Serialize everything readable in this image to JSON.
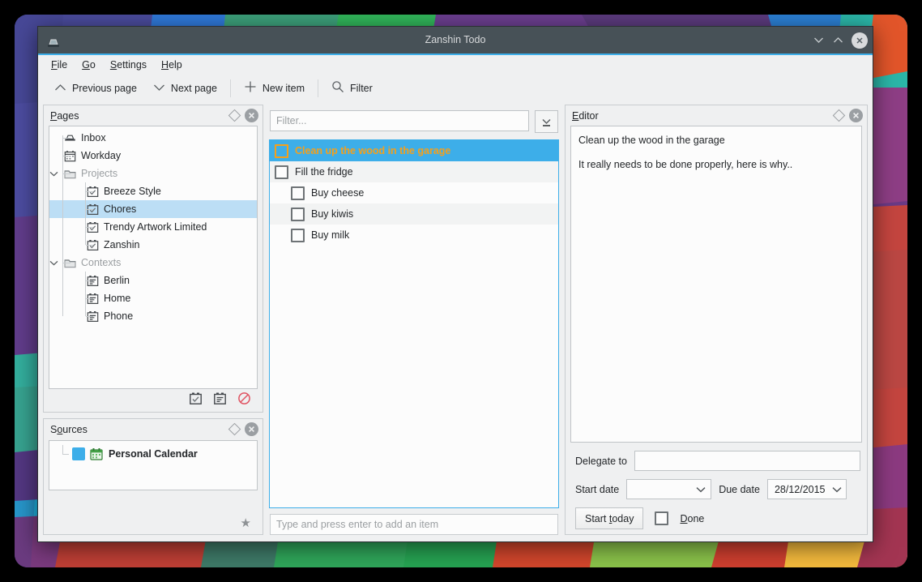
{
  "window": {
    "title": "Zanshin Todo",
    "app_icon": "inbox-icon",
    "minimize_label": "v",
    "maximize_label": "^",
    "close_label": "✕"
  },
  "menubar": {
    "items": [
      {
        "label": "File",
        "accel": "F"
      },
      {
        "label": "Go",
        "accel": "G"
      },
      {
        "label": "Settings",
        "accel": "S"
      },
      {
        "label": "Help",
        "accel": "H"
      }
    ]
  },
  "toolbar": {
    "buttons": [
      {
        "label": "Previous page",
        "icon": "chevron-up-icon"
      },
      {
        "label": "Next page",
        "icon": "chevron-down-icon"
      },
      {
        "label": "New item",
        "icon": "plus-icon"
      },
      {
        "label": "Filter",
        "icon": "search-icon"
      }
    ]
  },
  "pages_panel": {
    "title": "Pages",
    "title_accel": "P",
    "float_icon": "float-icon",
    "close_icon": "close-icon",
    "tree": [
      {
        "label": "Inbox",
        "icon": "inbox-icon",
        "depth": 0,
        "type": "item",
        "selected": false,
        "expander": ""
      },
      {
        "label": "Workday",
        "icon": "calendar-icon",
        "depth": 0,
        "type": "item",
        "selected": false,
        "expander": ""
      },
      {
        "label": "Projects",
        "icon": "folder-icon",
        "depth": 0,
        "type": "group",
        "selected": false,
        "expander": "∨"
      },
      {
        "label": "Breeze Style",
        "icon": "project-icon",
        "depth": 1,
        "type": "item",
        "selected": false,
        "expander": ""
      },
      {
        "label": "Chores",
        "icon": "project-icon",
        "depth": 1,
        "type": "item",
        "selected": true,
        "expander": ""
      },
      {
        "label": "Trendy Artwork Limited",
        "icon": "project-icon",
        "depth": 1,
        "type": "item",
        "selected": false,
        "expander": ""
      },
      {
        "label": "Zanshin",
        "icon": "project-icon",
        "depth": 1,
        "type": "item",
        "selected": false,
        "expander": ""
      },
      {
        "label": "Contexts",
        "icon": "folder-icon",
        "depth": 0,
        "type": "group",
        "selected": false,
        "expander": "∨"
      },
      {
        "label": "Berlin",
        "icon": "context-icon",
        "depth": 1,
        "type": "item",
        "selected": false,
        "expander": ""
      },
      {
        "label": "Home",
        "icon": "context-icon",
        "depth": 1,
        "type": "item",
        "selected": false,
        "expander": ""
      },
      {
        "label": "Phone",
        "icon": "context-icon",
        "depth": 1,
        "type": "item",
        "selected": false,
        "expander": ""
      }
    ],
    "footer_icons": [
      "add-project-icon",
      "add-context-icon",
      "remove-page-icon"
    ]
  },
  "sources_panel": {
    "title": "Sources",
    "title_accel": "o",
    "float_icon": "float-icon",
    "close_icon": "close-icon",
    "items": [
      {
        "label": "Personal Calendar",
        "icon": "calendar-source-icon",
        "checked": true
      }
    ],
    "footer_icon": "default-source-star-icon"
  },
  "task_list": {
    "filter_placeholder": "Filter...",
    "filter_value": "",
    "dropdown_icon": "sort-descending-icon",
    "items": [
      {
        "label": "Clean up the wood in the garage",
        "selected": true,
        "indent": false,
        "checked": false,
        "alt": false
      },
      {
        "label": "Fill the fridge",
        "selected": false,
        "indent": false,
        "checked": false,
        "alt": true
      },
      {
        "label": "Buy cheese",
        "selected": false,
        "indent": true,
        "checked": false,
        "alt": false
      },
      {
        "label": "Buy kiwis",
        "selected": false,
        "indent": true,
        "checked": false,
        "alt": true
      },
      {
        "label": "Buy milk",
        "selected": false,
        "indent": true,
        "checked": false,
        "alt": false
      }
    ],
    "add_placeholder": "Type and press enter to add an item",
    "add_value": ""
  },
  "editor_panel": {
    "title": "Editor",
    "title_accel": "E",
    "float_icon": "float-icon",
    "close_icon": "close-icon",
    "text_title": "Clean up the wood in the garage",
    "text_body": "It really needs to be done properly, here is why..",
    "delegate_label": "Delegate to",
    "delegate_value": "",
    "start_date_label": "Start date",
    "start_date_value": "",
    "due_date_label": "Due date",
    "due_date_value": "28/12/2015",
    "start_today_label": "Start today",
    "start_today_accel": "t",
    "done_label": "Done",
    "done_accel": "D",
    "done_checked": false,
    "chevron_icon": "chevron-down-icon"
  },
  "colors": {
    "accent": "#3daee9",
    "selected_task_text": "#f6a019",
    "tree_selection": "#bcdef5",
    "titlebar": "#475157",
    "window_bg": "#eff0f1"
  }
}
